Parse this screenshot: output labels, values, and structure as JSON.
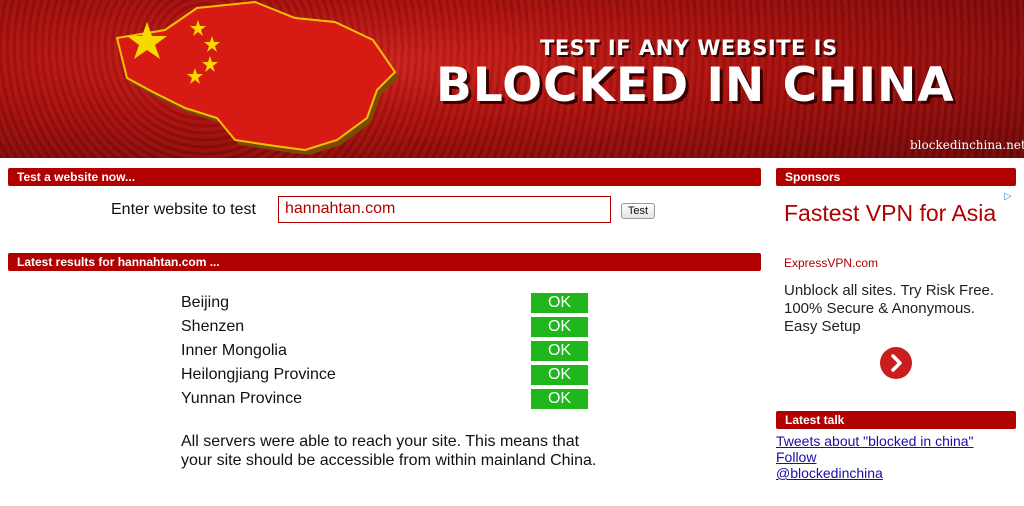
{
  "banner": {
    "line1": "TEST IF ANY WEBSITE IS",
    "line2": "BLOCKED IN CHINA",
    "domain": "blockedinchina.net"
  },
  "test_section": {
    "header": "Test a website now...",
    "label": "Enter website to test",
    "input_value": "hannahtan.com",
    "button_label": "Test"
  },
  "results_section": {
    "header": "Latest results for hannahtan.com ...",
    "rows": [
      {
        "location": "Beijing",
        "status": "OK"
      },
      {
        "location": "Shenzen",
        "status": "OK"
      },
      {
        "location": "Inner Mongolia",
        "status": "OK"
      },
      {
        "location": "Heilongjiang Province",
        "status": "OK"
      },
      {
        "location": "Yunnan Province",
        "status": "OK"
      }
    ],
    "message": "All servers were able to reach your site. This means that your site should be accessible from within mainland China."
  },
  "sponsors": {
    "header": "Sponsors",
    "ad_title": "Fastest VPN for Asia",
    "ad_url": "ExpressVPN.com",
    "ad_body": "Unblock all sites. Try Risk Free. 100% Secure & Anonymous. Easy Setup",
    "adchoices_icon": "adchoices-triangle-icon",
    "go_icon": "chevron-right-icon"
  },
  "latest_talk": {
    "header": "Latest talk",
    "links": [
      "Tweets about \"blocked in china\"",
      "Follow",
      "@blockedinchina"
    ]
  },
  "colors": {
    "brand_red": "#b00000",
    "ok_green": "#1fb71c",
    "link_blue": "#1a0dab"
  }
}
